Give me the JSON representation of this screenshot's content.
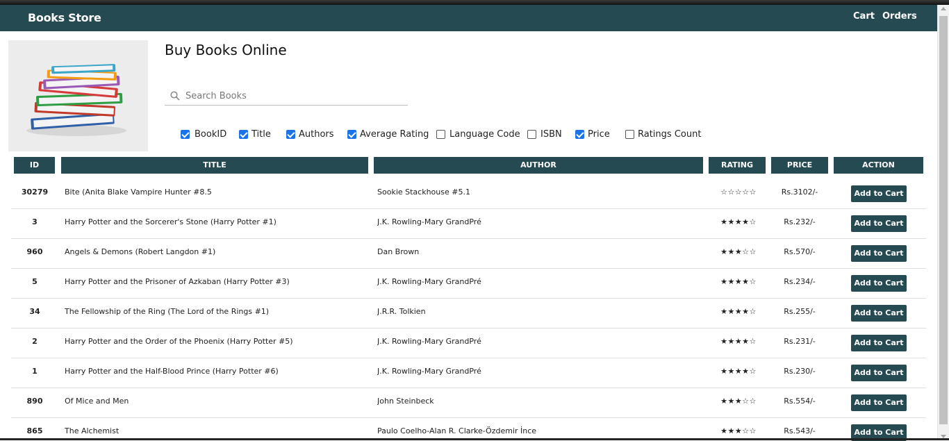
{
  "brand": "Books Store",
  "nav": {
    "cart": "Cart",
    "orders": "Orders"
  },
  "page_title": "Buy Books Online",
  "search": {
    "placeholder": "Search Books",
    "value": ""
  },
  "filters": [
    {
      "label": "BookID",
      "checked": true
    },
    {
      "label": "Title",
      "checked": true
    },
    {
      "label": "Authors",
      "checked": true
    },
    {
      "label": "Average Rating",
      "checked": true
    },
    {
      "label": "Language Code",
      "checked": false
    },
    {
      "label": "ISBN",
      "checked": false
    },
    {
      "label": "Price",
      "checked": true
    },
    {
      "label": "Ratings Count",
      "checked": false
    }
  ],
  "table": {
    "headers": {
      "id": "ID",
      "title": "TITLE",
      "author": "AUTHOR",
      "rating": "RATING",
      "price": "PRICE",
      "action": "ACTION"
    },
    "rows": [
      {
        "id": "30279",
        "title": "Bite (Anita Blake Vampire Hunter #8.5",
        "author": "Sookie Stackhouse #5.1",
        "rating": "☆☆☆☆☆",
        "price": "Rs.3102/-",
        "action": "Add to Cart"
      },
      {
        "id": "3",
        "title": "Harry Potter and the Sorcerer's Stone (Harry Potter #1)",
        "author": "J.K. Rowling-Mary GrandPré",
        "rating": "★★★★☆",
        "price": "Rs.232/-",
        "action": "Add to Cart"
      },
      {
        "id": "960",
        "title": "Angels & Demons (Robert Langdon #1)",
        "author": "Dan Brown",
        "rating": "★★★☆☆",
        "price": "Rs.570/-",
        "action": "Add to Cart"
      },
      {
        "id": "5",
        "title": "Harry Potter and the Prisoner of Azkaban (Harry Potter #3)",
        "author": "J.K. Rowling-Mary GrandPré",
        "rating": "★★★★☆",
        "price": "Rs.234/-",
        "action": "Add to Cart"
      },
      {
        "id": "34",
        "title": "The Fellowship of the Ring (The Lord of the Rings #1)",
        "author": "J.R.R. Tolkien",
        "rating": "★★★★☆",
        "price": "Rs.255/-",
        "action": "Add to Cart"
      },
      {
        "id": "2",
        "title": "Harry Potter and the Order of the Phoenix (Harry Potter #5)",
        "author": "J.K. Rowling-Mary GrandPré",
        "rating": "★★★★☆",
        "price": "Rs.231/-",
        "action": "Add to Cart"
      },
      {
        "id": "1",
        "title": "Harry Potter and the Half-Blood Prince (Harry Potter #6)",
        "author": "J.K. Rowling-Mary GrandPré",
        "rating": "★★★★☆",
        "price": "Rs.230/-",
        "action": "Add to Cart"
      },
      {
        "id": "890",
        "title": "Of Mice and Men",
        "author": "John Steinbeck",
        "rating": "★★★☆☆",
        "price": "Rs.554/-",
        "action": "Add to Cart"
      },
      {
        "id": "865",
        "title": "The Alchemist",
        "author": "Paulo Coelho-Alan R. Clarke-Özdemir İnce",
        "rating": "★★★☆☆",
        "price": "Rs.543/-",
        "action": "Add to Cart"
      }
    ]
  },
  "colors": {
    "header_bg": "#254a52",
    "checkbox_accent": "#1a73e8"
  },
  "icons": {
    "search": "search-icon",
    "hero": "books-stack-icon"
  }
}
